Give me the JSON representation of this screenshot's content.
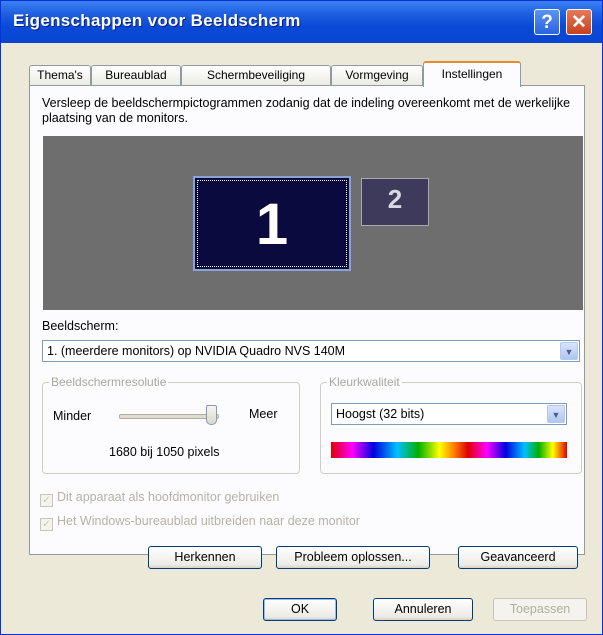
{
  "window": {
    "title": "Eigenschappen voor Beeldscherm",
    "help_label": "?",
    "close_label": "✕"
  },
  "tabs": [
    {
      "label": "Thema's"
    },
    {
      "label": "Bureaublad"
    },
    {
      "label": "Schermbeveiliging"
    },
    {
      "label": "Vormgeving"
    },
    {
      "label": "Instellingen",
      "active": true
    }
  ],
  "settings": {
    "instruction": "Versleep de beeldschermpictogrammen zodanig dat de indeling overeenkomt met de werkelijke plaatsing van de monitors.",
    "monitor1_label": "1",
    "monitor2_label": "2",
    "display_label": "Beeldscherm:",
    "display_value": "1. (meerdere monitors) op NVIDIA Quadro NVS 140M",
    "resolution_group": "Beeldschermresolutie",
    "less_label": "Minder",
    "more_label": "Meer",
    "resolution_value": "1680 bij 1050 pixels",
    "resolution_level": 1.0,
    "color_group": "Kleurkwaliteit",
    "color_value": "Hoogst (32 bits)",
    "primary_checkbox": "Dit apparaat als hoofdmonitor gebruiken",
    "extend_checkbox": "Het Windows-bureaublad uitbreiden naar deze monitor",
    "identify_button": "Herkennen",
    "troubleshoot_button": "Probleem oplossen...",
    "advanced_button": "Geavanceerd"
  },
  "footer": {
    "ok": "OK",
    "cancel": "Annuleren",
    "apply": "Toepassen"
  },
  "colors": {
    "titlebar": "#0a4ad8",
    "active_tab_accent": "#e68b2c",
    "monitor_bg": "#6e6e6e",
    "monitor1_fill": "#0b0a3e"
  }
}
